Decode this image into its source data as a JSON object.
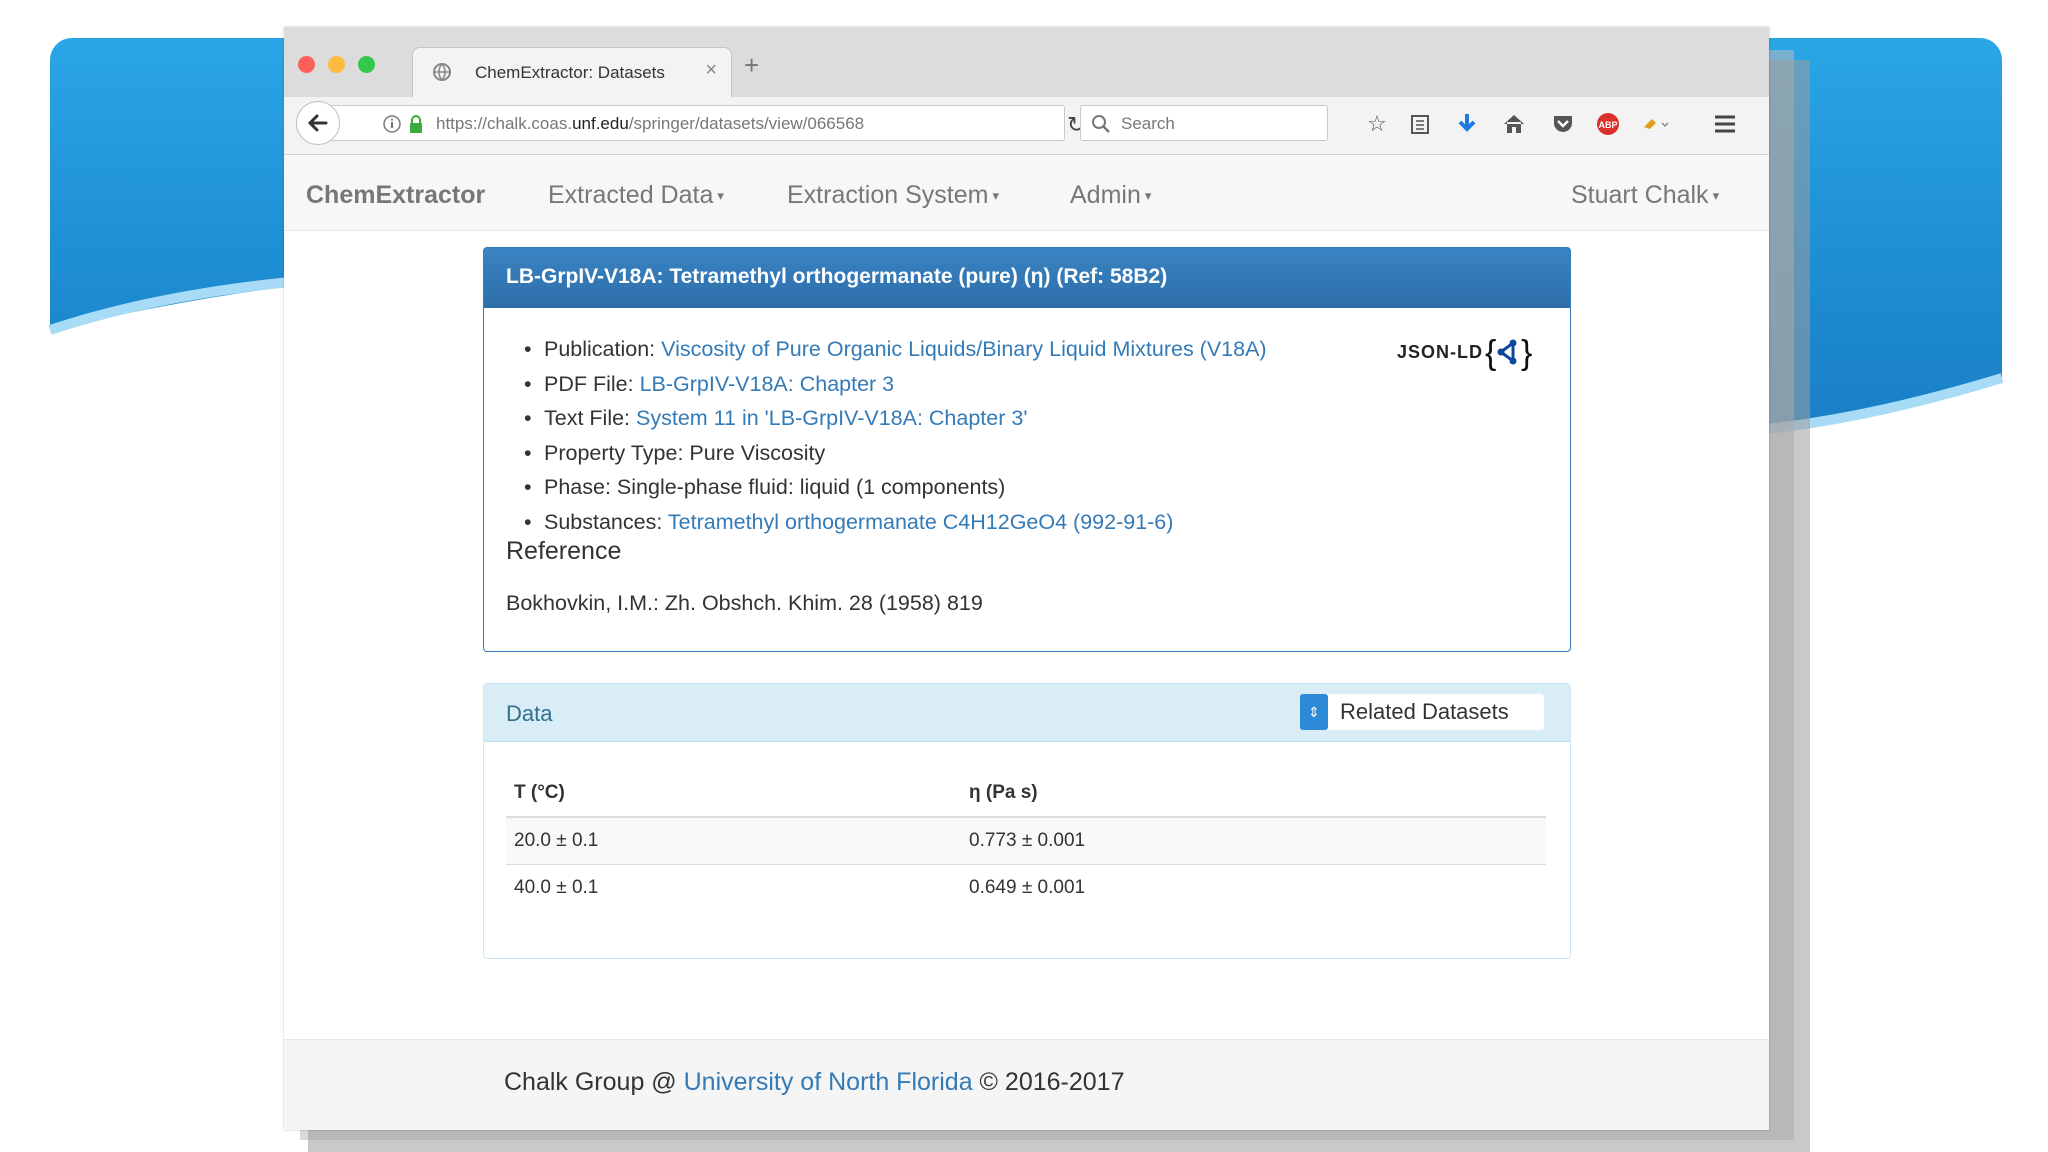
{
  "colors": {
    "slide_blue": "#1e8fd3",
    "panel_primary": "#337ab7",
    "panel_info_bg": "#d9edf7",
    "link": "#337ab7",
    "close_dot": "#fc605b",
    "minimize_dot": "#fdbc40",
    "zoom_dot": "#34c84a"
  },
  "browser": {
    "tab_title": "ChemExtractor: Datasets",
    "url_prefix": "https://chalk.coas.",
    "url_domain": "unf.edu",
    "url_path": "/springer/datasets/view/066568",
    "search_placeholder": "Search",
    "toolbar_icons": [
      "star-icon",
      "reading-list-icon",
      "download-icon",
      "home-icon",
      "pocket-icon",
      "adblock-icon",
      "extension-icon",
      "menu-icon"
    ]
  },
  "nav": {
    "brand": "ChemExtractor",
    "items": [
      "Extracted Data",
      "Extraction System",
      "Admin"
    ],
    "user": "Stuart Chalk"
  },
  "panel": {
    "title": "LB-GrpIV-V18A: Tetramethyl orthogermanate (pure) (η) (Ref: 58B2)",
    "publication_label": "Publication:",
    "publication_link": "Viscosity of Pure Organic Liquids/Binary Liquid Mixtures (V18A)",
    "pdf_label": "PDF File:",
    "pdf_link": "LB-GrpIV-V18A: Chapter 3",
    "text_label": "Text File:",
    "text_link": "System 11 in 'LB-GrpIV-V18A: Chapter 3'",
    "property_type": "Property Type: Pure Viscosity",
    "phase": "Phase: Single-phase fluid: liquid (1 components)",
    "substances_label": "Substances:",
    "substances_link": "Tetramethyl orthogermanate C4H12GeO4 (992-91-6)",
    "jsonld": "JSON-LD",
    "reference_heading": "Reference",
    "reference_text": "Bokhovkin, I.M.: Zh. Obshch. Khim. 28 (1958) 819"
  },
  "data_panel": {
    "title": "Data",
    "related_button": "Related Datasets",
    "columns": [
      "T (°C)",
      "η (Pa s)"
    ],
    "rows": [
      [
        "20.0 ± 0.1",
        "0.773 ± 0.001"
      ],
      [
        "40.0 ± 0.1",
        "0.649 ± 0.001"
      ]
    ]
  },
  "footer": {
    "prefix": "Chalk Group @ ",
    "link": "University of North Florida",
    "suffix": " © 2016-2017"
  }
}
